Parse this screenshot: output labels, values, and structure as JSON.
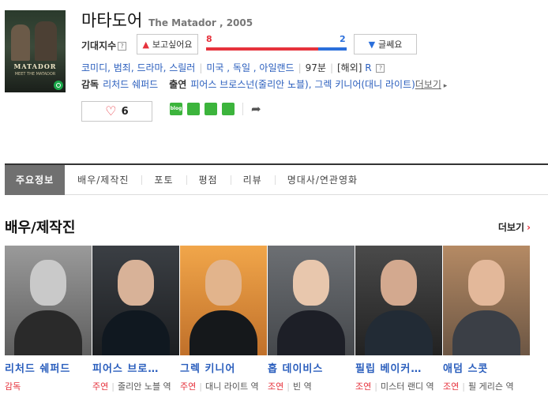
{
  "movie": {
    "title_ko": "마타도어",
    "title_en": "The Matador , 2005",
    "poster_text": "MATADOR",
    "poster_subtext": "MEET THE MATADOR"
  },
  "expectation": {
    "label": "기대지수",
    "like_label": "보고싶어요",
    "dislike_label": "글쎄요",
    "like_count": "8",
    "dislike_count": "2",
    "like_ratio": 0.8
  },
  "info": {
    "genres": "코미디, 범죄, 드라마, 스릴러",
    "countries": "미국 , 독일 , 아일랜드",
    "runtime": "97분",
    "release": "[해외]",
    "rating": "R"
  },
  "people": {
    "director_label": "감독",
    "director": "리처드 쉐퍼드",
    "cast_label": "출연",
    "cast_text": "피어스 브로스넌(줄리안 노블), 그렉 키니어(대니 라이트)",
    "more": "더보기"
  },
  "like": {
    "count": "6"
  },
  "share": [
    "blog",
    "cafe",
    "band",
    "line"
  ],
  "tabs": [
    "주요정보",
    "배우/제작진",
    "포토",
    "평점",
    "리뷰",
    "명대사/연관영화"
  ],
  "section": {
    "title": "배우/제작진",
    "more": "더보기"
  },
  "cast_list": [
    {
      "name": "리처드 쉐퍼드",
      "role_type": "감독",
      "role_name": ""
    },
    {
      "name": "피어스 브로…",
      "role_type": "주연",
      "role_name": "줄리안 노블 역"
    },
    {
      "name": "그렉 키니어",
      "role_type": "주연",
      "role_name": "대니 라이트 역"
    },
    {
      "name": "홉 데이비스",
      "role_type": "조연",
      "role_name": "빈 역"
    },
    {
      "name": "필립 베이커…",
      "role_type": "조연",
      "role_name": "미스터 랜디 역"
    },
    {
      "name": "애덤 스콧",
      "role_type": "조연",
      "role_name": "필 게리슨 역"
    }
  ]
}
